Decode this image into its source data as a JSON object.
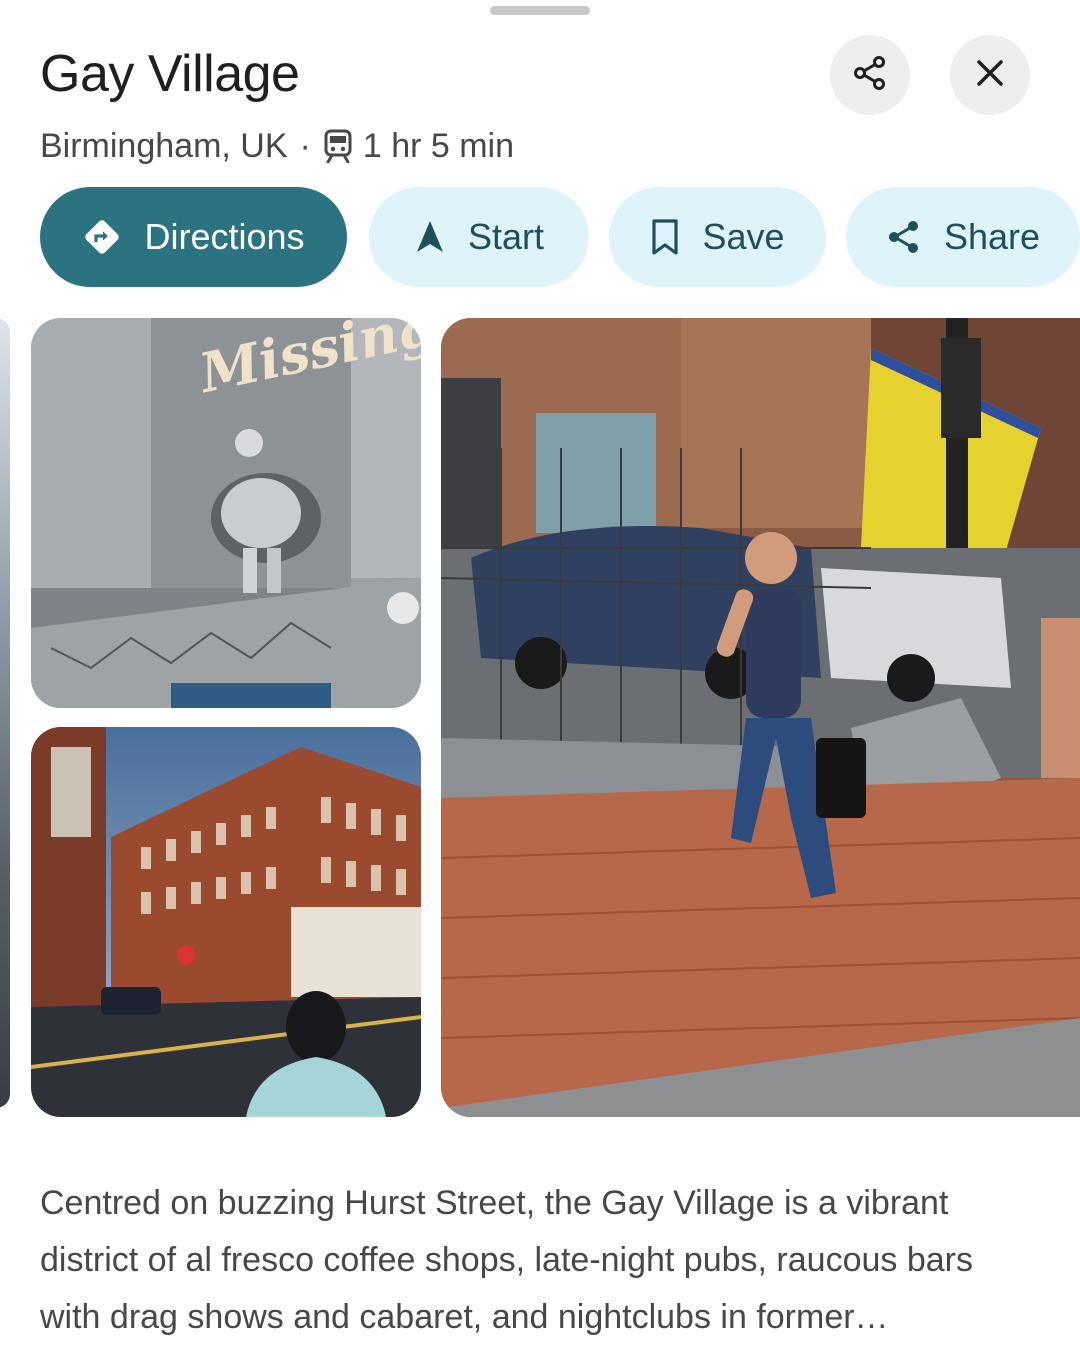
{
  "place": {
    "title": "Gay Village",
    "location": "Birmingham, UK",
    "separator": "·",
    "transit_icon": "train-icon",
    "travel_time": "1 hr 5 min"
  },
  "header_buttons": {
    "share_icon": "share-icon",
    "close_icon": "close-icon"
  },
  "actions": [
    {
      "label": "Directions",
      "icon": "directions-icon"
    },
    {
      "label": "Start",
      "icon": "navigation-arrow-icon"
    },
    {
      "label": "Save",
      "icon": "bookmark-icon"
    },
    {
      "label": "Share",
      "icon": "share-icon"
    }
  ],
  "photos": {
    "photo1_sign": "Missing"
  },
  "description": "Centred on buzzing Hurst Street, the Gay Village is a vibrant district of al fresco coffee shops, late-night pubs, raucous bars with drag shows and cabaret, and nightclubs in former…",
  "colors": {
    "primary": "#2c7382",
    "tonal": "#dff3fb",
    "text_primary": "#1f1f1f",
    "text_secondary": "#474747"
  }
}
